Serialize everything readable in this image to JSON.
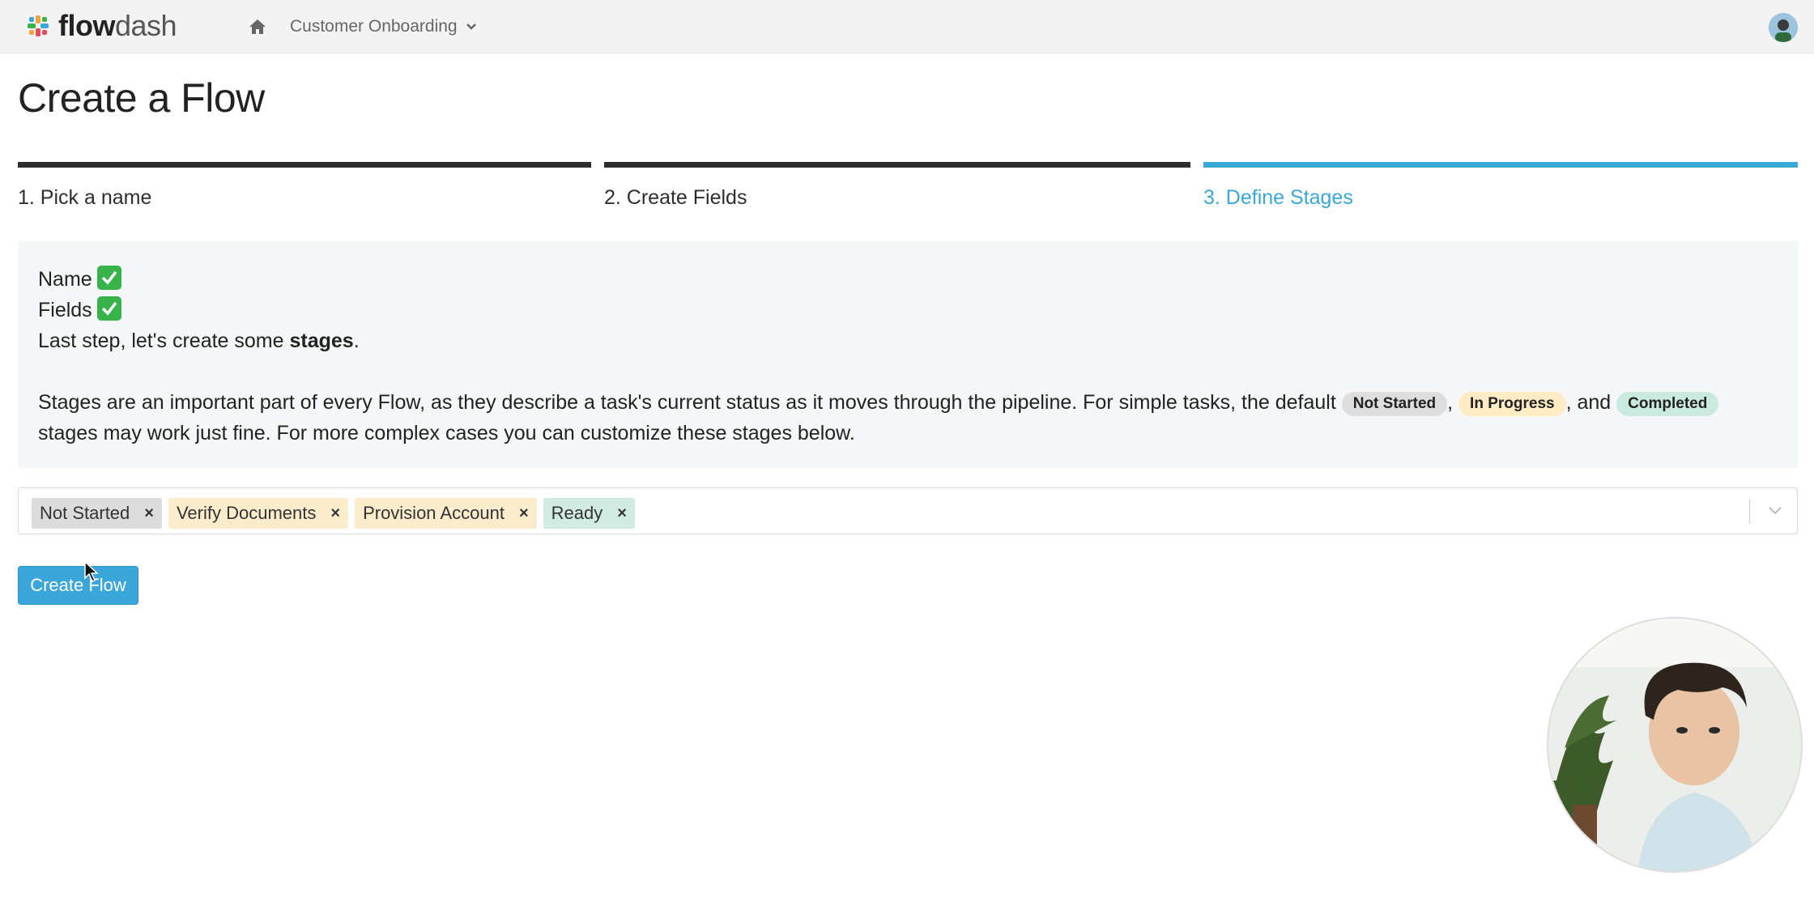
{
  "header": {
    "logo_bold": "flow",
    "logo_light": "dash",
    "breadcrumb": "Customer Onboarding"
  },
  "page": {
    "title": "Create a Flow"
  },
  "steps": [
    {
      "label": "1. Pick a name",
      "state": "done"
    },
    {
      "label": "2. Create Fields",
      "state": "done"
    },
    {
      "label": "3. Define Stages",
      "state": "active"
    }
  ],
  "info": {
    "name_line": "Name",
    "fields_line": "Fields",
    "last_step_prefix": "Last step, let's create some ",
    "last_step_bold": "stages",
    "last_step_suffix": ".",
    "para_prefix": "Stages are an important part of every Flow, as they describe a task's current status as it moves through the pipeline. For simple tasks, the default ",
    "pill_not_started": "Not Started",
    "sep_comma": ",",
    "pill_in_progress": "In Progress",
    "sep_and": ", and",
    "pill_completed": "Completed",
    "para_suffix": "stages may work just fine. For more complex cases you can customize these stages below."
  },
  "stages": [
    {
      "label": "Not Started",
      "remove": "×"
    },
    {
      "label": "Verify Documents",
      "remove": "×"
    },
    {
      "label": "Provision Account",
      "remove": "×"
    },
    {
      "label": "Ready",
      "remove": "×"
    }
  ],
  "actions": {
    "create_label": "Create Flow"
  },
  "colors": {
    "accent": "#39a8d6",
    "step_done": "#2e2e2e",
    "check": "#37b34a",
    "stage_grey": "#dcdcdc",
    "stage_yellow": "#fbedcc",
    "stage_green": "#d2ebe2"
  },
  "icons": [
    "logo-mark-icon",
    "home-icon",
    "chevron-down-icon",
    "check-icon",
    "close-icon",
    "cursor-icon"
  ]
}
